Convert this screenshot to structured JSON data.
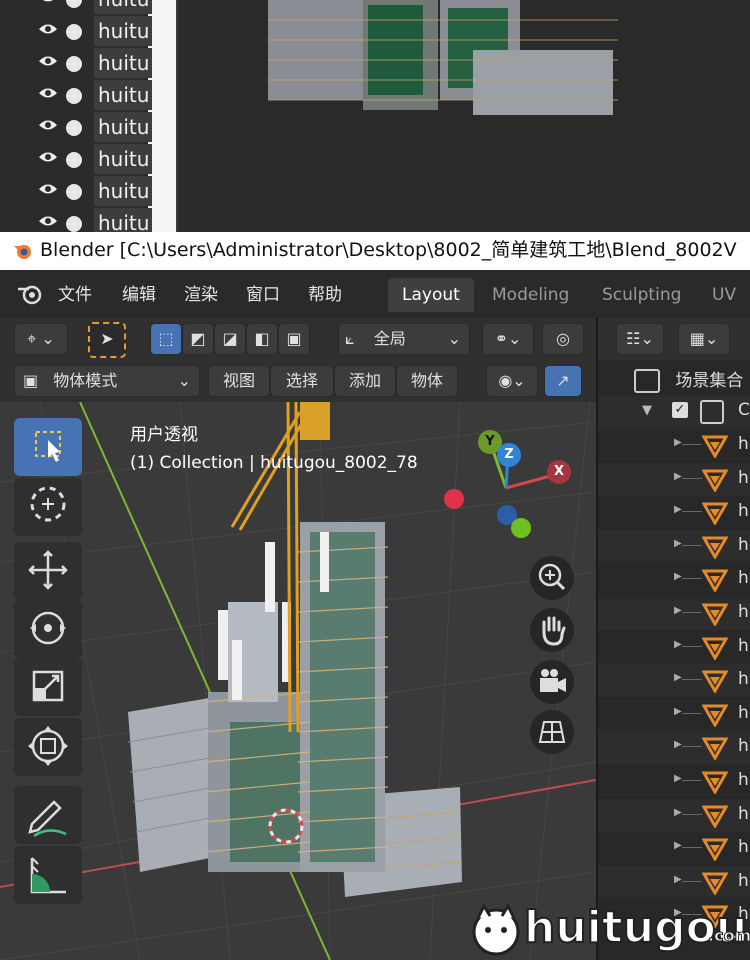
{
  "old_screenshot": {
    "outliner_rows": [
      "huitu",
      "huitu",
      "huitu",
      "huitu",
      "huitu",
      "huitu",
      "huitu",
      "huitu"
    ]
  },
  "titlebar": {
    "title": "Blender [C:\\Users\\Administrator\\Desktop\\8002_简单建筑工地\\Blend_8002V"
  },
  "menubar": {
    "items": [
      "文件",
      "编辑",
      "渲染",
      "窗口",
      "帮助"
    ],
    "workspace_tabs": [
      "Layout",
      "Modeling",
      "Sculpting",
      "UV E"
    ],
    "active_tab": "Layout"
  },
  "toolbar1": {
    "transform_orientation": "全局"
  },
  "toolbar2": {
    "mode": "物体模式",
    "menus": [
      "视图",
      "选择",
      "添加",
      "物体"
    ]
  },
  "viewport": {
    "view_name": "用户透视",
    "collection_info": "(1) Collection | huitugou_8002_78",
    "gizmo_axes": {
      "x": "X",
      "y": "Y",
      "z": "Z"
    },
    "colors": {
      "x_axis": "#d8474d",
      "y_axis": "#7cba2f",
      "z_axis": "#2f85d8",
      "selection": "#4772b3"
    }
  },
  "outliner": {
    "scene_collection": "场景集合",
    "collection_prefix": "C",
    "object_prefix": "hu",
    "object_count": 15
  },
  "watermark": {
    "text": "huitugou",
    "suffix": ".com"
  }
}
